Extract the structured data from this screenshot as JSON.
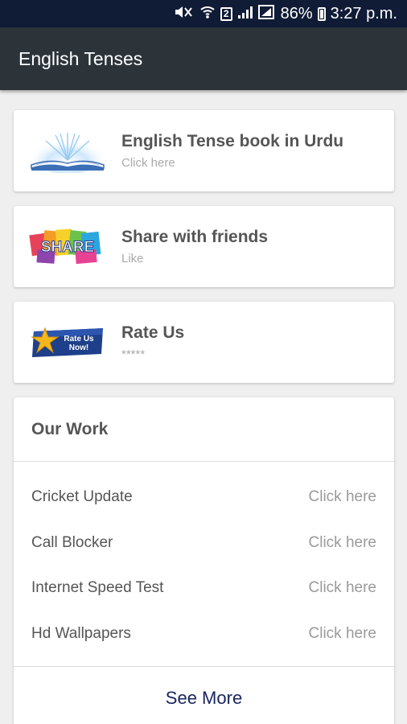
{
  "status_bar": {
    "battery": "86%",
    "time": "3:27 p.m.",
    "sim_badge": "2"
  },
  "app_bar": {
    "title": "English Tenses"
  },
  "cards": [
    {
      "title": "English Tense book in Urdu",
      "subtitle": "Click here",
      "icon": "open-book-icon"
    },
    {
      "title": "Share with friends",
      "subtitle": "Like",
      "icon": "share-badge-icon",
      "icon_text": "SHARE"
    },
    {
      "title": "Rate Us",
      "subtitle": "*****",
      "icon": "rate-us-badge-icon",
      "icon_text": "Rate Us Now!"
    }
  ],
  "our_work": {
    "title": "Our Work",
    "items": [
      {
        "label": "Cricket Update",
        "link": "Click here"
      },
      {
        "label": "Call Blocker",
        "link": "Click here"
      },
      {
        "label": "Internet Speed Test",
        "link": "Click here"
      },
      {
        "label": "Hd Wallpapers",
        "link": "Click here"
      }
    ],
    "see_more": "See More"
  },
  "colors": {
    "status_bar": "#101b36",
    "app_bar": "#2c343a",
    "background": "#efefef",
    "see_more": "#1a2660"
  }
}
